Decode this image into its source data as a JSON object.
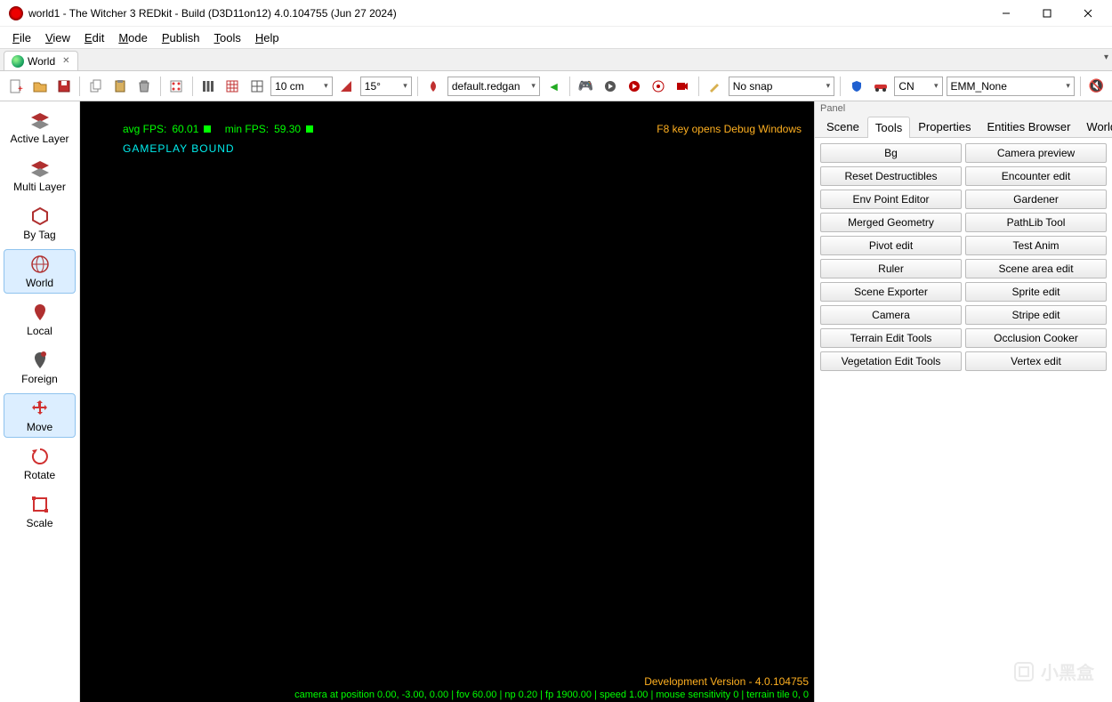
{
  "window": {
    "title": "world1 - The Witcher 3 REDkit - Build  (D3D11on12) 4.0.104755  (Jun 27 2024)"
  },
  "menubar": [
    "File",
    "View",
    "Edit",
    "Mode",
    "Publish",
    "Tools",
    "Help"
  ],
  "doc_tab": {
    "label": "World"
  },
  "toolbar": {
    "grid_unit": "10 cm",
    "angle": "15°",
    "material": "default.redgan",
    "snap": "No snap",
    "region": "CN",
    "emm": "EMM_None"
  },
  "sidebar": [
    {
      "label": "Active Layer",
      "icon": "layers"
    },
    {
      "label": "Multi Layer",
      "icon": "layers"
    },
    {
      "label": "By Tag",
      "icon": "hex"
    },
    {
      "label": "World",
      "icon": "globe",
      "selected": true
    },
    {
      "label": "Local",
      "icon": "pin"
    },
    {
      "label": "Foreign",
      "icon": "pin2"
    },
    {
      "label": "Move",
      "icon": "move",
      "selected": true
    },
    {
      "label": "Rotate",
      "icon": "rotate"
    },
    {
      "label": "Scale",
      "icon": "scale"
    }
  ],
  "viewport": {
    "avg_fps_label": "avg FPS:",
    "avg_fps": "60.01",
    "min_fps_label": "min FPS:",
    "min_fps": "59.30",
    "gameplay": "GAMEPLAY BOUND",
    "f8": "F8 key opens Debug Windows",
    "dev": "Development Version - 4.0.104755",
    "cam": "camera at position 0.00, -3.00, 0.00 | fov 60.00 | np 0.20 | fp 1900.00 | speed 1.00 | mouse sensitivity 0 | terrain tile 0, 0"
  },
  "panel": {
    "title": "Panel",
    "tabs": [
      "Scene",
      "Tools",
      "Properties",
      "Entities Browser",
      "World"
    ],
    "active_tab": 1,
    "tools_left": [
      "Bg",
      "Reset Destructibles",
      "Env Point Editor",
      "Merged Geometry",
      "Pivot edit",
      "Ruler",
      "Scene Exporter",
      "Camera",
      "Terrain Edit Tools",
      "Vegetation Edit Tools"
    ],
    "tools_right": [
      "Camera preview",
      "Encounter edit",
      "Gardener",
      "PathLib Tool",
      "Test Anim",
      "Scene area edit",
      "Sprite edit",
      "Stripe edit",
      "Occlusion Cooker",
      "Vertex edit"
    ]
  },
  "watermark": "小黑盒"
}
